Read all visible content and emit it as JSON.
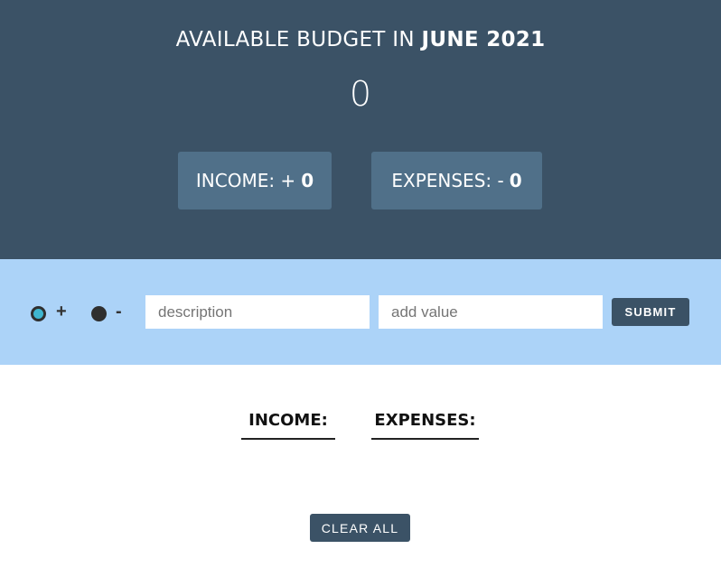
{
  "header": {
    "title_prefix": "AVAILABLE BUDGET IN",
    "month": "JUNE 2021",
    "available_budget": "0",
    "income": {
      "label": "INCOME: +",
      "value": "0"
    },
    "expenses": {
      "label": "EXPENSES: -",
      "value": "0"
    },
    "background_color": "#3b5266",
    "box_color": "#507089"
  },
  "input_bar": {
    "type_options": [
      {
        "sign": "+",
        "selected": true
      },
      {
        "sign": "-",
        "selected": false
      }
    ],
    "description_placeholder": "description",
    "value_placeholder": "add value",
    "submit_label": "SUBMIT",
    "background_color": "#acd3f8"
  },
  "lists": {
    "income_heading": "INCOME:",
    "expenses_heading": "EXPENSES:"
  },
  "clear_all_label": "CLEAR ALL"
}
